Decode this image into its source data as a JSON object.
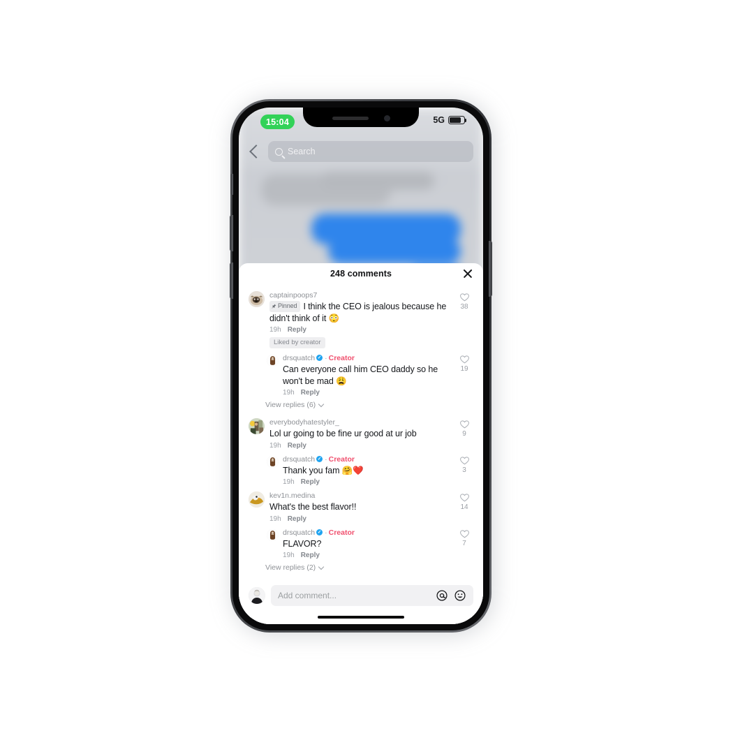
{
  "status_bar": {
    "time": "15:04",
    "network": "5G",
    "battery_icon": "battery-icon"
  },
  "background_app": {
    "search_placeholder": "Search",
    "back_icon": "back-chevron-icon",
    "search_icon": "search-icon"
  },
  "comments_sheet": {
    "title": "248 comments",
    "close_icon": "close-icon",
    "comments": [
      {
        "username": "captainpoops7",
        "verified": false,
        "creator_label": "",
        "pinned_label": "Pinned",
        "text": "I think the CEO is jealous because he didn't think of it 😳",
        "time": "19h",
        "reply_label": "Reply",
        "likes": "38",
        "liked_by_creator": "Liked by creator",
        "avatar_type": "dog-photo",
        "replies": [
          {
            "username": "drsquatch",
            "verified": true,
            "creator_label": "Creator",
            "text": "Can everyone call him CEO daddy so he won't be mad 😩",
            "time": "19h",
            "reply_label": "Reply",
            "likes": "19",
            "avatar_type": "drsquatch-logo"
          }
        ],
        "view_replies": "View replies (6)"
      },
      {
        "username": "everybodyhatestyler_",
        "verified": false,
        "creator_label": "",
        "pinned_label": "",
        "text": "Lol ur going to be fine ur good at ur job",
        "time": "19h",
        "reply_label": "Reply",
        "likes": "9",
        "liked_by_creator": "",
        "avatar_type": "group-photo",
        "replies": [
          {
            "username": "drsquatch",
            "verified": true,
            "creator_label": "Creator",
            "text": "Thank you fam 🤗❤️",
            "time": "19h",
            "reply_label": "Reply",
            "likes": "3",
            "avatar_type": "drsquatch-logo"
          }
        ],
        "view_replies": ""
      },
      {
        "username": "kev1n.medina",
        "verified": false,
        "creator_label": "",
        "pinned_label": "",
        "text": "What's the best flavor!!",
        "time": "19h",
        "reply_label": "Reply",
        "likes": "14",
        "liked_by_creator": "",
        "avatar_type": "eagle-photo",
        "replies": [
          {
            "username": "drsquatch",
            "verified": true,
            "creator_label": "Creator",
            "text": "FLAVOR?",
            "time": "19h",
            "reply_label": "Reply",
            "likes": "7",
            "avatar_type": "drsquatch-logo"
          }
        ],
        "view_replies": "View replies (2)"
      }
    ]
  },
  "composer": {
    "placeholder": "Add comment...",
    "mention_icon": "at-mention-icon",
    "emoji_icon": "emoji-smiley-icon",
    "avatar": "user-avatar"
  },
  "colors": {
    "verified_blue": "#20a4f0",
    "creator_pink": "#f0506e",
    "status_green": "#32d258",
    "bubble_blue": "#2f85ec"
  }
}
